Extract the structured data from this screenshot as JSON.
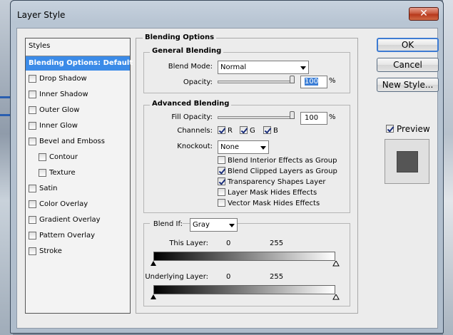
{
  "window": {
    "title": "Layer Style",
    "close_glyph": "✕"
  },
  "styles_panel": {
    "header": "Styles",
    "items": [
      {
        "label": "Blending Options: Default",
        "selected": true,
        "has_checkbox": false
      },
      {
        "label": "Drop Shadow",
        "checked": false
      },
      {
        "label": "Inner Shadow",
        "checked": false
      },
      {
        "label": "Outer Glow",
        "checked": false
      },
      {
        "label": "Inner Glow",
        "checked": false
      },
      {
        "label": "Bevel and Emboss",
        "checked": false
      },
      {
        "label": "Contour",
        "checked": false,
        "indent": true
      },
      {
        "label": "Texture",
        "checked": false,
        "indent": true
      },
      {
        "label": "Satin",
        "checked": false
      },
      {
        "label": "Color Overlay",
        "checked": false
      },
      {
        "label": "Gradient Overlay",
        "checked": false
      },
      {
        "label": "Pattern Overlay",
        "checked": false
      },
      {
        "label": "Stroke",
        "checked": false
      }
    ]
  },
  "blending": {
    "section_title": "Blending Options",
    "general": {
      "title": "General Blending",
      "blend_mode_label": "Blend Mode:",
      "blend_mode_value": "Normal",
      "opacity_label": "Opacity:",
      "opacity_value": "100",
      "opacity_unit": "%",
      "opacity_level": 1.0
    },
    "advanced": {
      "title": "Advanced Blending",
      "fill_opacity_label": "Fill Opacity:",
      "fill_opacity_value": "100",
      "fill_opacity_unit": "%",
      "fill_opacity_level": 1.0,
      "channels_label": "Channels:",
      "channels": [
        {
          "label": "R",
          "checked": true
        },
        {
          "label": "G",
          "checked": true
        },
        {
          "label": "B",
          "checked": true
        }
      ],
      "knockout_label": "Knockout:",
      "knockout_value": "None",
      "options": [
        {
          "label": "Blend Interior Effects as Group",
          "checked": false
        },
        {
          "label": "Blend Clipped Layers as Group",
          "checked": true
        },
        {
          "label": "Transparency Shapes Layer",
          "checked": true
        },
        {
          "label": "Layer Mask Hides Effects",
          "checked": false
        },
        {
          "label": "Vector Mask Hides Effects",
          "checked": false
        }
      ]
    },
    "blend_if": {
      "label": "Blend If:",
      "value": "Gray",
      "this_layer_label": "This Layer:",
      "this_layer_min": "0",
      "this_layer_max": "255",
      "underlying_label": "Underlying Layer:",
      "underlying_min": "0",
      "underlying_max": "255"
    }
  },
  "buttons": {
    "ok": "OK",
    "cancel": "Cancel",
    "new_style": "New Style...",
    "preview_label": "Preview",
    "preview_checked": true
  }
}
